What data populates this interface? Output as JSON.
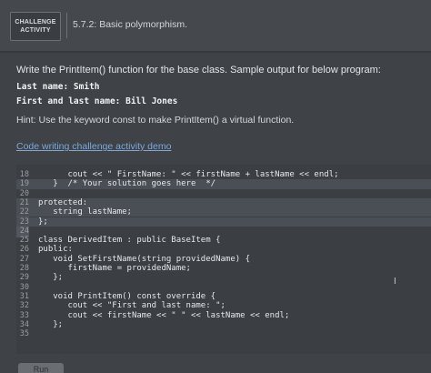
{
  "header": {
    "badge_label": "CHALLENGE\nACTIVITY",
    "activity_title": "5.7.2: Basic polymorphism."
  },
  "prompt": "Write the PrintItem() function for the base class. Sample output for below program:",
  "sample_output": [
    "Last name: Smith",
    "First and last name: Bill Jones"
  ],
  "hint": "Hint: Use the keyword const to make PrintItem() a virtual function.",
  "demo_link": "Code writing challenge activity demo",
  "editor": {
    "note": "",
    "lines": [
      {
        "n": "18",
        "text": "      cout << \" FirstName: \" << firstName + lastName << endl;"
      },
      {
        "n": "19",
        "text": "   }  /* Your solution goes here  */"
      },
      {
        "n": "20",
        "text": ""
      },
      {
        "n": "21",
        "text": "protected:"
      },
      {
        "n": "22",
        "text": "   string lastName;"
      },
      {
        "n": "23",
        "text": "};"
      },
      {
        "n": "24",
        "text": ""
      },
      {
        "n": "25",
        "text": "class DerivedItem : public BaseItem {"
      },
      {
        "n": "26",
        "text": "public:"
      },
      {
        "n": "27",
        "text": "   void SetFirstName(string providedName) {"
      },
      {
        "n": "28",
        "text": "      firstName = providedName;"
      },
      {
        "n": "29",
        "text": "   };"
      },
      {
        "n": "30",
        "text": ""
      },
      {
        "n": "31",
        "text": "   void PrintItem() const override {"
      },
      {
        "n": "32",
        "text": "      cout << \"First and last name: \";"
      },
      {
        "n": "33",
        "text": "      cout << firstName << \" \" << lastName << endl;"
      },
      {
        "n": "34",
        "text": "   };"
      },
      {
        "n": "35",
        "text": ""
      }
    ]
  },
  "run_button": "Run"
}
